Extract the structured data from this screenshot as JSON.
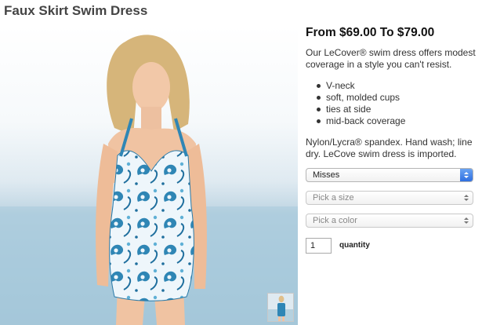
{
  "product": {
    "title": "Faux Skirt Swim Dress",
    "price_range": "From $69.00 To $79.00",
    "description": "Our LeCover® swim dress offers modest coverage in a style you can't resist.",
    "features": [
      "V-neck",
      "soft, molded cups",
      "ties at side",
      "mid-back coverage"
    ],
    "material": "Nylon/Lycra® spandex. Hand wash; line dry. LeCove swim dress is imported."
  },
  "options": {
    "size_range": {
      "value": "Misses"
    },
    "size": {
      "placeholder": "Pick a size"
    },
    "color": {
      "placeholder": "Pick a color"
    }
  },
  "quantity": {
    "value": "1",
    "label": "quantity"
  },
  "colors": {
    "sky": "#e4eef4",
    "sea": "#a9cbdc",
    "swimsuit_blue": "#2f86b5",
    "focus_blue": "#3b78e7"
  },
  "icons": {
    "select_arrows": "chevron-up-down-icon",
    "bullet": "disc"
  }
}
